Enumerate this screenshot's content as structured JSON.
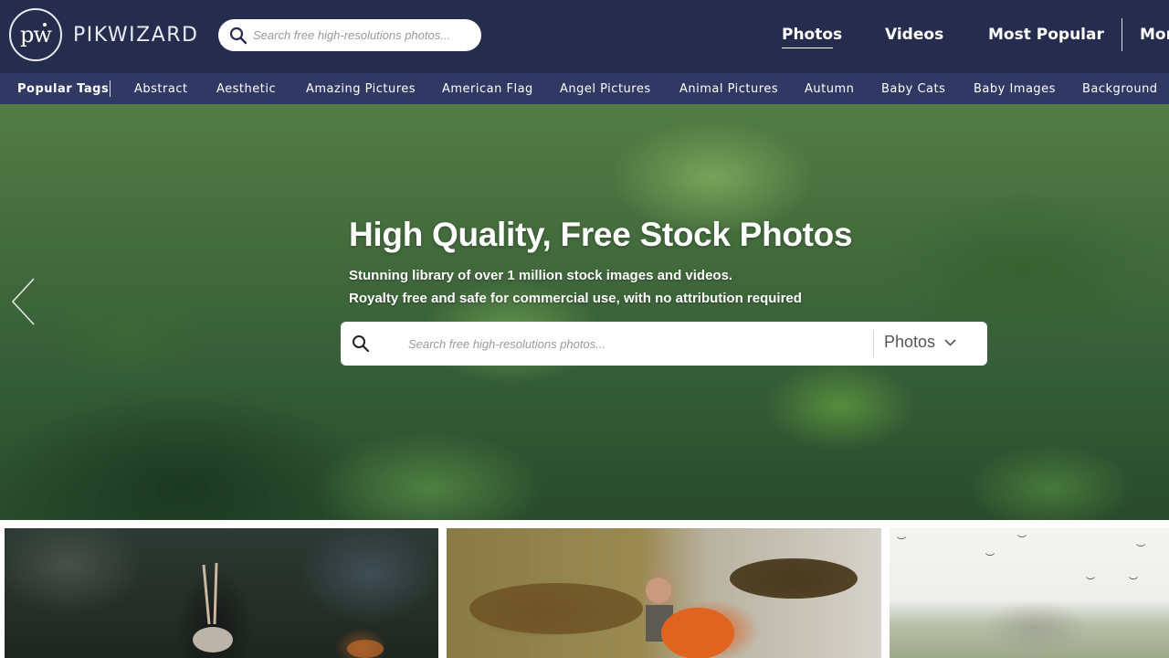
{
  "header": {
    "logo_mark": "pw",
    "logo_text": "PIKWIZARD",
    "search_placeholder": "Search free high-resolutions photos...",
    "nav": [
      {
        "label": "Photos",
        "active": true
      },
      {
        "label": "Videos",
        "active": false
      },
      {
        "label": "Most Popular",
        "active": false
      },
      {
        "label": "More",
        "active": false
      }
    ]
  },
  "tags": {
    "heading": "Popular Tags",
    "items": [
      "Abstract",
      "Aesthetic",
      "Amazing Pictures",
      "American Flag",
      "Angel Pictures",
      "Animal Pictures",
      "Autumn",
      "Baby Cats",
      "Baby Images",
      "Background"
    ]
  },
  "hero": {
    "title": "High Quality, Free Stock Photos",
    "subtitle_line1": "Stunning library of over 1 million stock images and videos.",
    "subtitle_line2": "Royalty free and safe for commercial use, with no attribution required",
    "search_placeholder": "Search free high-resolutions photos...",
    "search_type": "Photos"
  },
  "colors": {
    "header_bg": "#262c4d",
    "tagbar_bg": "#303964",
    "text_light": "#ffffff"
  },
  "icons": {
    "search": "search-icon",
    "chevron": "chevron-down-icon",
    "prev": "chevron-left-icon"
  }
}
